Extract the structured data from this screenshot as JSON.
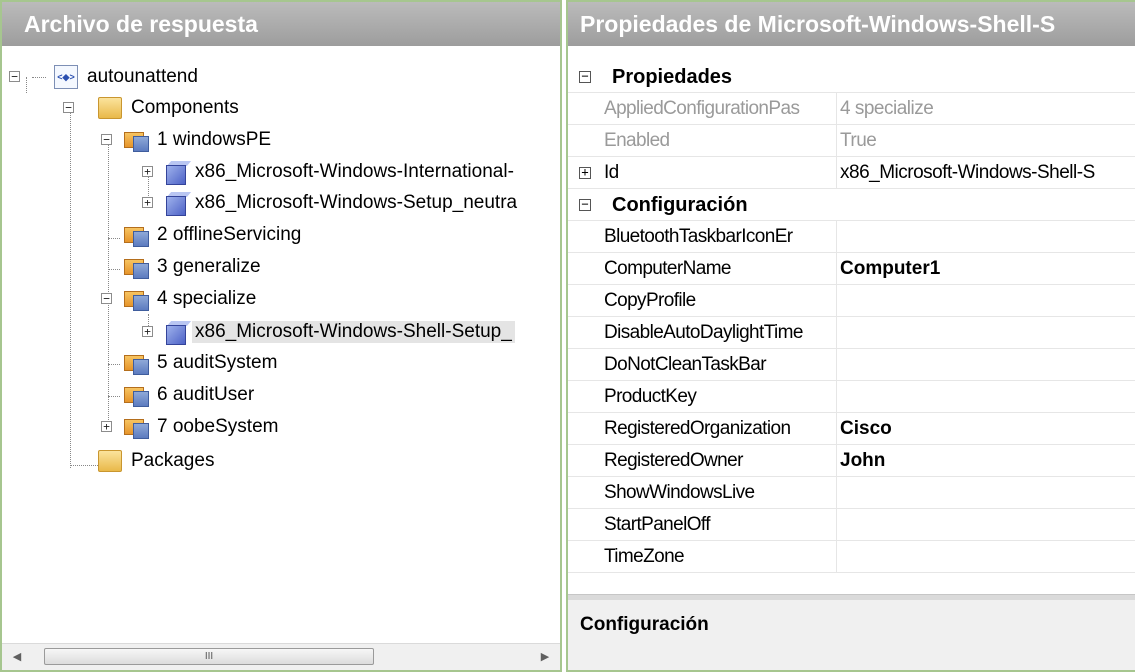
{
  "left_pane": {
    "title": "Archivo de respuesta",
    "tree": {
      "root": "autounattend",
      "components": "Components",
      "passes": [
        {
          "label": "1 windowsPE",
          "children": [
            "x86_Microsoft-Windows-International-",
            "x86_Microsoft-Windows-Setup_neutra"
          ]
        },
        {
          "label": "2 offlineServicing"
        },
        {
          "label": "3 generalize"
        },
        {
          "label": "4 specialize",
          "children": [
            "x86_Microsoft-Windows-Shell-Setup_"
          ]
        },
        {
          "label": "5 auditSystem"
        },
        {
          "label": "6 auditUser"
        },
        {
          "label": "7 oobeSystem"
        }
      ],
      "packages": "Packages",
      "selected": "x86_Microsoft-Windows-Shell-Setup_"
    },
    "scrollbar": {
      "thumb_grip": "III",
      "left_arrow": "◀",
      "right_arrow": "▶"
    }
  },
  "right_pane": {
    "title": "Propiedades de Microsoft-Windows-Shell-S",
    "categories": {
      "propiedades": "Propiedades",
      "configuracion": "Configuración"
    },
    "properties": [
      {
        "name": "AppliedConfigurationPas",
        "value": "4 specialize"
      },
      {
        "name": "Enabled",
        "value": "True"
      },
      {
        "name": "Id",
        "value": "x86_Microsoft-Windows-Shell-S"
      }
    ],
    "settings": [
      {
        "name": "BluetoothTaskbarIconEr",
        "value": ""
      },
      {
        "name": "ComputerName",
        "value": "Computer1"
      },
      {
        "name": "CopyProfile",
        "value": ""
      },
      {
        "name": "DisableAutoDaylightTime",
        "value": ""
      },
      {
        "name": "DoNotCleanTaskBar",
        "value": ""
      },
      {
        "name": "ProductKey",
        "value": ""
      },
      {
        "name": "RegisteredOrganization",
        "value": "Cisco"
      },
      {
        "name": "RegisteredOwner",
        "value": "John"
      },
      {
        "name": "ShowWindowsLive",
        "value": ""
      },
      {
        "name": "StartPanelOff",
        "value": ""
      },
      {
        "name": "TimeZone",
        "value": ""
      }
    ],
    "description_title": "Configuración"
  },
  "colors": {
    "pane_border": "#a6c68f",
    "title_bar": "#a8a8a8",
    "selection": "#e4e4e4"
  }
}
